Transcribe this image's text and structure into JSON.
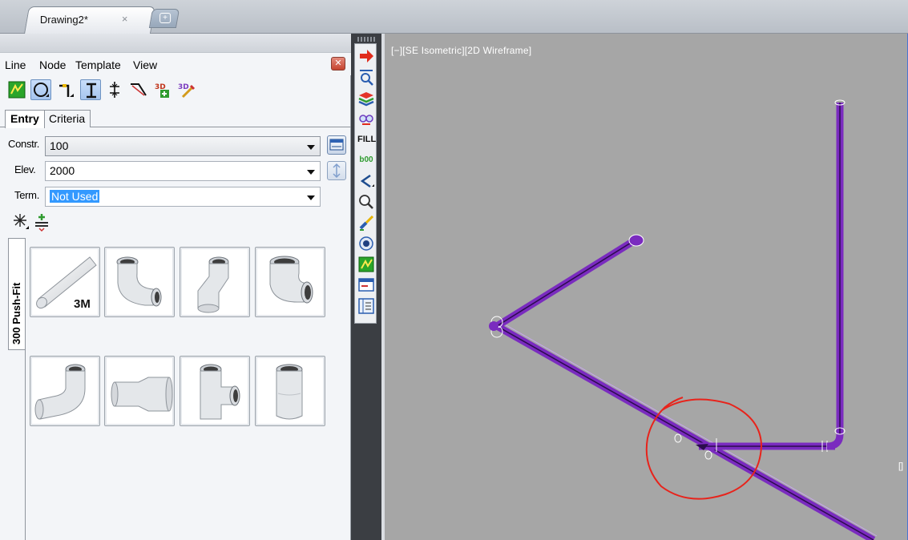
{
  "tabbar": {
    "active_tab": "Drawing2*",
    "close_glyph": "×",
    "new_tab_icon": "new-tab-icon"
  },
  "palette": {
    "menu": [
      "Line",
      "Node",
      "Template",
      "View"
    ],
    "close_glyph": "✕",
    "tabs": [
      "Entry",
      "Criteria"
    ],
    "fields": {
      "constr": {
        "label": "Constr.",
        "value": "100"
      },
      "elev": {
        "label": "Elev.",
        "value": "2000"
      },
      "term": {
        "label": "Term.",
        "value": "Not Used"
      }
    },
    "catalog_tab": "300 Push-Fit",
    "fittings": [
      {
        "label": "3M",
        "icon": "straight-pipe-icon"
      },
      {
        "label": "",
        "icon": "elbow-90-icon"
      },
      {
        "label": "",
        "icon": "elbow-45-icon"
      },
      {
        "label": "",
        "icon": "elbow-short-icon"
      },
      {
        "label": "",
        "icon": "elbow-long-icon"
      },
      {
        "label": "",
        "icon": "reducer-icon"
      },
      {
        "label": "",
        "icon": "tee-icon"
      },
      {
        "label": "",
        "icon": "coupling-icon"
      }
    ],
    "colors": {
      "accent": "#3399ff",
      "pipe": "#7a2bbf",
      "annotation": "#e8231b"
    }
  },
  "vtoolbar": {
    "icons": [
      "red-arrow-icon",
      "zoom-icon",
      "layers-icon",
      "glasses-icon",
      "fill-icon",
      "b00-icon",
      "chevron-left-icon",
      "magnifier-icon",
      "brush-icon",
      "eye-icon",
      "green-grid-icon",
      "window-icon",
      "panel-icon"
    ],
    "fill_text": "FILL",
    "b00_text": "b00"
  },
  "viewport": {
    "label": "[−][SE Isometric][2D Wireframe]",
    "edge_marker": "[]"
  }
}
